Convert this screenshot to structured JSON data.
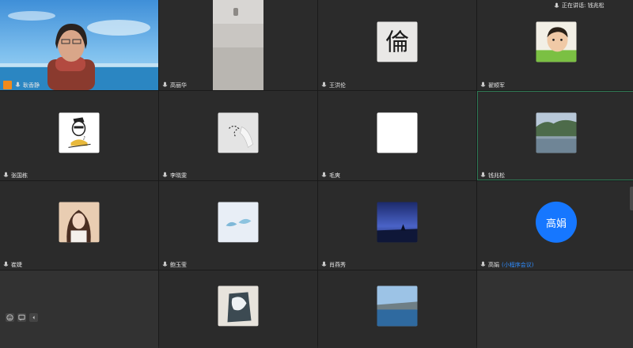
{
  "speaking": {
    "label": "正在讲话: 钱兆松"
  },
  "tiles": [
    {
      "name": "耿香静"
    },
    {
      "name": "高丽华"
    },
    {
      "name": "王洪伦"
    },
    {
      "name": "翟顺军"
    },
    {
      "name": "张国栋"
    },
    {
      "name": "李晓雯"
    },
    {
      "name": "毛爽"
    },
    {
      "name": "钱兆松"
    },
    {
      "name": "崔婕"
    },
    {
      "name": "鲍玉莹"
    },
    {
      "name": "肖燕秀"
    },
    {
      "name": "高娟",
      "note": "(小程序会议)",
      "avatar_text": "高娟"
    }
  ],
  "colors": {
    "host_badge": "#f08a1d",
    "avatar": "#1677ff",
    "active_border": "#2f7a55"
  }
}
